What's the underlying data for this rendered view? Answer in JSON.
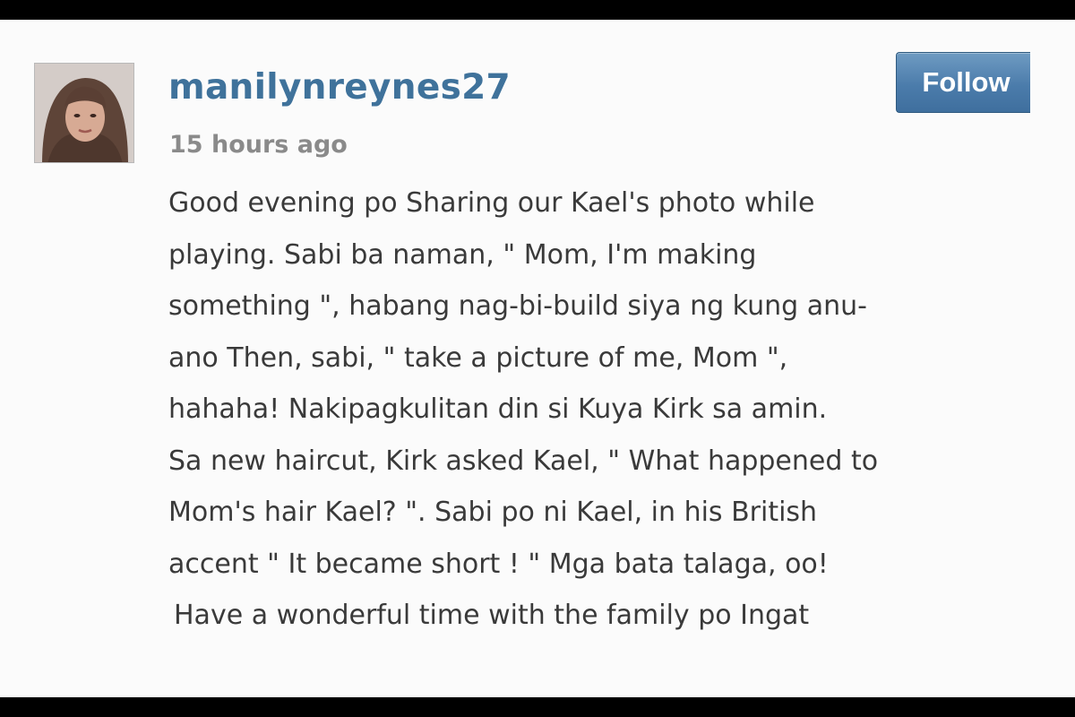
{
  "post": {
    "username": "manilynreynes27",
    "timestamp": "15 hours ago",
    "follow_label": "Follow",
    "caption_lines": [
      "Good evening po  Sharing our Kael's photo while",
      "playing. Sabi ba naman, \" Mom, I'm making",
      "something \", habang nag-bi-build siya ng kung anu-",
      "ano Then, sabi, \" take a picture of me, Mom \",",
      "hahaha!  Nakipagkulitan din si Kuya Kirk sa amin.",
      "Sa new haircut, Kirk asked Kael, \" What happened to",
      "Mom's hair Kael? \". Sabi po ni Kael, in his British",
      "accent \" It became short ! \"  Mga bata talaga, oo! ",
      "Have a wonderful time with the family po  Ingat",
      ""
    ]
  },
  "colors": {
    "username": "#3f729b",
    "timestamp": "#8a8a8a",
    "caption": "#3a3a3a",
    "follow_button": "#4b7cab",
    "background": "#fbfbfb"
  }
}
